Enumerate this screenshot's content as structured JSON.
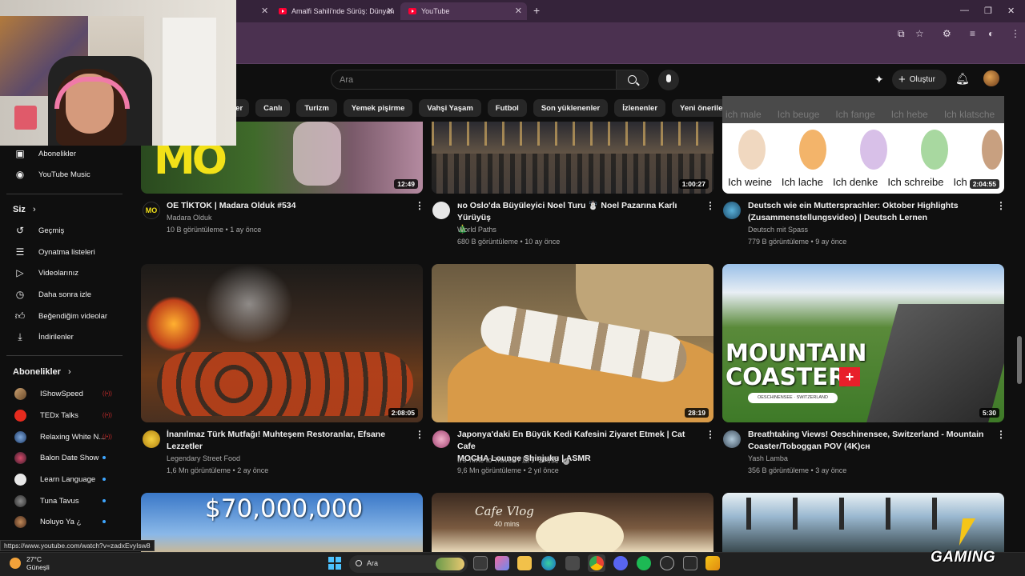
{
  "browser": {
    "tabs": [
      {
        "title": "Amalfi Sahili'nde Sürüş: Dünyan"
      },
      {
        "title": "YouTube"
      }
    ]
  },
  "header": {
    "search_placeholder": "Ara",
    "create_label": "Oluştur"
  },
  "chips": [
    "k'ler",
    "Canlı",
    "Turizm",
    "Yemek pişirme",
    "Vahşi Yaşam",
    "Futbol",
    "Son yüklenenler",
    "İzlenenler",
    "Yeni öneriler"
  ],
  "sidebar": {
    "top_items": [
      {
        "label": "Abonelikler"
      },
      {
        "label": "YouTube Music"
      }
    ],
    "you_header": "Siz",
    "you_items": [
      {
        "label": "Geçmiş"
      },
      {
        "label": "Oynatma listeleri"
      },
      {
        "label": "Videolarınız"
      },
      {
        "label": "Daha sonra izle"
      },
      {
        "label": "Beğendiğim videolar"
      },
      {
        "label": "İndirilenler"
      }
    ],
    "subs_header": "Abonelikler",
    "subscriptions": [
      {
        "name": "IShowSpeed",
        "status": "live"
      },
      {
        "name": "TEDx Talks",
        "status": "live"
      },
      {
        "name": "Relaxing White N...",
        "status": "live"
      },
      {
        "name": "Balon Date Show",
        "status": "new"
      },
      {
        "name": "Learn Language",
        "status": "new"
      },
      {
        "name": "Tuna Tavus",
        "status": "new"
      },
      {
        "name": "Noluyo Ya ¿",
        "status": "new"
      }
    ]
  },
  "videos": [
    {
      "title_1": "OE TİKTOK | Madara Olduk #534",
      "title_2": "",
      "channel": "Madara Olduk",
      "meta": "10 B görüntüleme • 1 ay önce",
      "duration": "12:49",
      "thumb_text": "MO"
    },
    {
      "title_1": "ɴᴏ Oslo'da Büyüleyici Noel Turu ☃️ Noel Pazarına Karlı Yürüyüş",
      "title_2": "🎄",
      "channel": "World Paths",
      "meta": "680 B görüntüleme • 10 ay önce",
      "duration": "1:00:27"
    },
    {
      "title_1": "Deutsch wie ein Muttersprachler: Oktober Highlights",
      "title_2": "(Zusammenstellungsvideo) | Deutsch Lernen",
      "channel": "Deutsch mit Spass",
      "meta": "779 B görüntüleme • 9 ay önce",
      "duration": "2:04:55",
      "thumb_words_top": [
        "ich male",
        "Ich beuge",
        "Ich fange",
        "Ich hebe",
        "Ich klatsche"
      ],
      "thumb_words": [
        "Ich weine",
        "Ich lache",
        "Ich denke",
        "Ich schreibe",
        "Ich"
      ]
    },
    {
      "title_1": "İnanılmaz Türk Mutfağı! Muhteşem Restoranlar, Efsane",
      "title_2": "Lezzetler",
      "channel": "Legendary Street Food",
      "meta": "1,6 Mn görüntüleme • 2 ay önce",
      "duration": "2:08:05"
    },
    {
      "title_1": "Japonya'daki En Büyük Kedi Kafesini Ziyaret Etmek | Cat Cafe",
      "title_2": "MOCHA Lounge Shinjuku | ASMR",
      "channel": "It's Time to Travelᵍ / 旅する時間",
      "meta": "9,6 Mn görüntüleme • 2 yıl önce",
      "duration": "28:19"
    },
    {
      "title_1": "Breathtaking Views! Oeschinensee, Switzerland - Mountain",
      "title_2": "Coaster/Toboggan POV (4K)ᴄʜ",
      "channel": "Yash Lamba",
      "meta": "356 B görüntüleme • 3 ay önce",
      "duration": "5:30",
      "thumb_line_1": "MOUNTAIN",
      "thumb_line_2": "COASTER",
      "thumb_tag": "OESCHINENSEE · SWITZERLAND"
    },
    {
      "thumb_text": "$70,000,000"
    },
    {
      "thumb_text": "Cafe Vlog",
      "thumb_sub": "40 mins"
    },
    {
      "thumb_text": ""
    }
  ],
  "status_url": "https://www.youtube.com/watch?v=zadxEvyIsw8",
  "taskbar": {
    "weather_temp": "27°C",
    "weather_desc": "Güneşli",
    "search": "Ara"
  },
  "watermark": "GAMING",
  "colors": {
    "accent_red": "#ff0033",
    "chrome_purple": "#4b3150",
    "bg": "#0f0f0f"
  }
}
